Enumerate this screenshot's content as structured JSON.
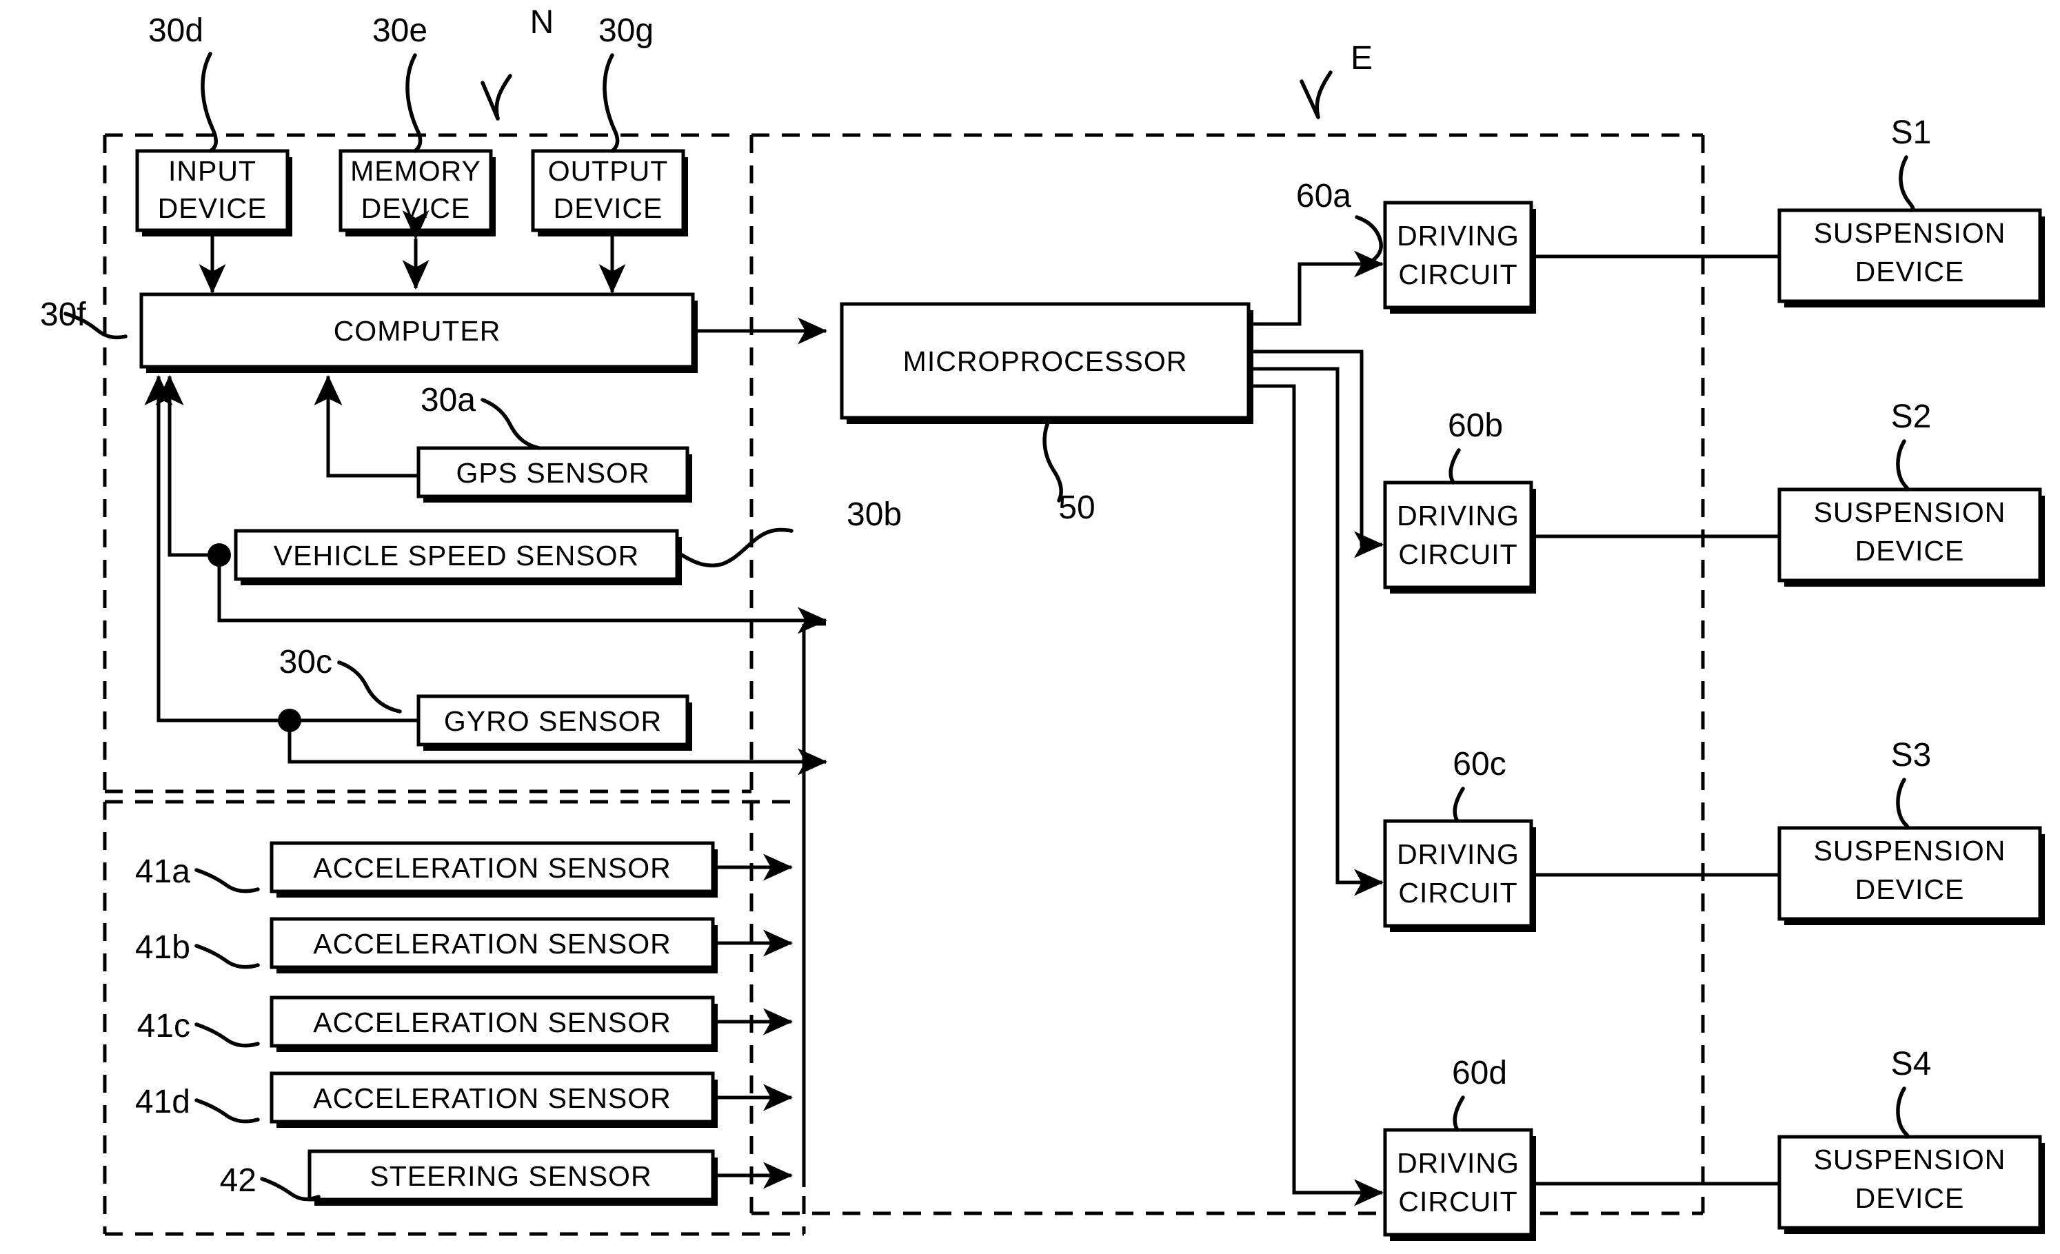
{
  "figure": {
    "type": "patent-block-diagram",
    "title": "Vehicle suspension control block diagram"
  },
  "groups": {
    "navigation": {
      "ref": "N",
      "label_ref": "N"
    },
    "ecu": {
      "ref": "E",
      "label_ref": "E"
    },
    "sensor_unit": {
      "ref": ""
    }
  },
  "blocks": {
    "input_device": {
      "line1": "INPUT",
      "line2": "DEVICE",
      "ref": "30d"
    },
    "memory_device": {
      "line1": "MEMORY",
      "line2": "DEVICE",
      "ref": "30e"
    },
    "output_device": {
      "line1": "OUTPUT",
      "line2": "DEVICE",
      "ref": "30g"
    },
    "computer": {
      "label": "COMPUTER",
      "ref": "30f"
    },
    "gps_sensor": {
      "label": "GPS  SENSOR",
      "ref": "30a"
    },
    "vehicle_speed_sensor": {
      "label": "VEHICLE  SPEED  SENSOR",
      "ref": "30b"
    },
    "gyro_sensor": {
      "label": "GYRO  SENSOR",
      "ref": "30c"
    },
    "microprocessor": {
      "label": "MICROPROCESSOR",
      "ref": "50"
    },
    "acceleration_sensor_a": {
      "label": "ACCELERATION  SENSOR",
      "ref": "41a"
    },
    "acceleration_sensor_b": {
      "label": "ACCELERATION  SENSOR",
      "ref": "41b"
    },
    "acceleration_sensor_c": {
      "label": "ACCELERATION  SENSOR",
      "ref": "41c"
    },
    "acceleration_sensor_d": {
      "label": "ACCELERATION  SENSOR",
      "ref": "41d"
    },
    "steering_sensor": {
      "label": "STEERING  SENSOR",
      "ref": "42"
    },
    "driving_circuit_a": {
      "line1": "DRIVING",
      "line2": "CIRCUIT",
      "ref": "60a"
    },
    "driving_circuit_b": {
      "line1": "DRIVING",
      "line2": "CIRCUIT",
      "ref": "60b"
    },
    "driving_circuit_c": {
      "line1": "DRIVING",
      "line2": "CIRCUIT",
      "ref": "60c"
    },
    "driving_circuit_d": {
      "line1": "DRIVING",
      "line2": "CIRCUIT",
      "ref": "60d"
    },
    "suspension_device_1": {
      "line1": "SUSPENSION",
      "line2": "DEVICE",
      "ref": "S1"
    },
    "suspension_device_2": {
      "line1": "SUSPENSION",
      "line2": "DEVICE",
      "ref": "S2"
    },
    "suspension_device_3": {
      "line1": "SUSPENSION",
      "line2": "DEVICE",
      "ref": "S3"
    },
    "suspension_device_4": {
      "line1": "SUSPENSION",
      "line2": "DEVICE",
      "ref": "S4"
    }
  },
  "colors": {
    "ink": "#000000",
    "paper": "#ffffff"
  }
}
